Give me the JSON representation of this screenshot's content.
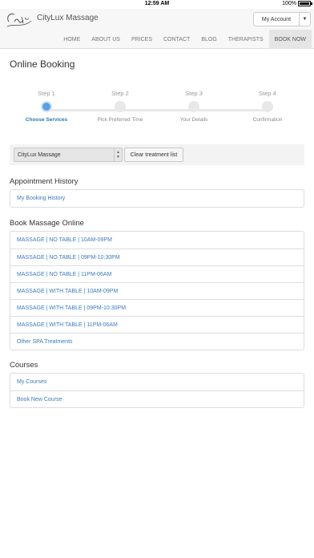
{
  "status_bar": {
    "time": "12:59 AM",
    "battery": "100%"
  },
  "header": {
    "logo_text": "CityLux",
    "brand": "CityLux Massage",
    "account_button": "My Account",
    "nav": [
      "HOME",
      "ABOUT US",
      "PRICES",
      "CONTACT",
      "BLOG",
      "THERAPISTS",
      "BOOK NOW"
    ],
    "active_nav": "BOOK NOW"
  },
  "page_title": "Online Booking",
  "steps": [
    {
      "num": "Step 1",
      "name": "Choose Services",
      "active": true
    },
    {
      "num": "Step 2",
      "name": "Pick Preferred Time",
      "active": false
    },
    {
      "num": "Step 3",
      "name": "Your Details",
      "active": false
    },
    {
      "num": "Step 4",
      "name": "Confirmation",
      "active": false
    }
  ],
  "toolbar": {
    "location_select": "CityLux Massage",
    "clear_button": "Clear treatment list"
  },
  "appointment_history": {
    "title": "Appointment History",
    "items": [
      "My Booking History"
    ]
  },
  "book_massage": {
    "title": "Book Massage Online",
    "items": [
      "MASSAGE | NO TABLE | 10AM-09PM",
      "MASSAGE | NO TABLE | 09PM-10:30PM",
      "MASSAGE | NO TABLE | 11PM-06AM",
      "MASSAGE | WITH TABLE | 10AM-09PM",
      "MASSAGE | WITH TABLE | 09PM-10:30PM",
      "MASSAGE | WITH TABLE | 11PM-06AM",
      "Other SPA Treatments"
    ]
  },
  "courses": {
    "title": "Courses",
    "items": [
      "My Courses",
      "Book New Course"
    ]
  }
}
